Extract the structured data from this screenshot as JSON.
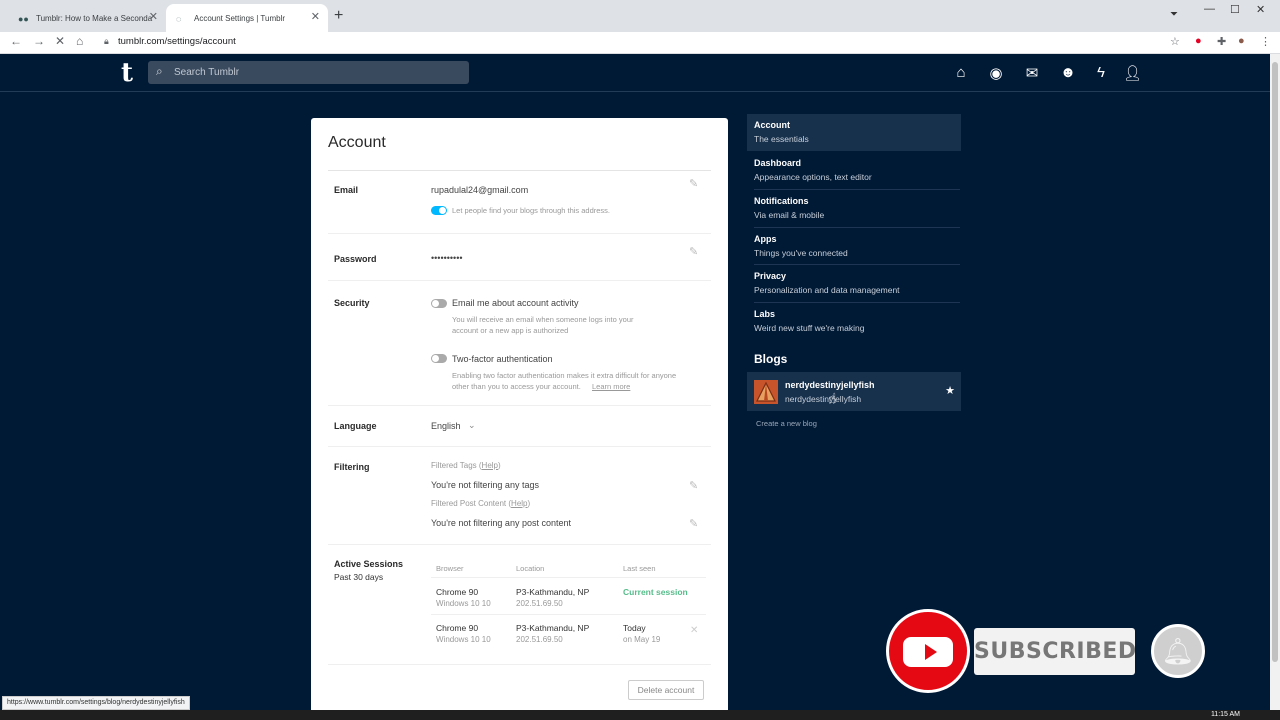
{
  "browser": {
    "tabs": [
      {
        "title": "Tumblr: How to Make a Seconda"
      },
      {
        "title": "Account Settings | Tumblr"
      }
    ],
    "url": "tumblr.com/settings/account",
    "status_url": "https://www.tumblr.com/settings/blog/nerdydestinyjellyfish"
  },
  "header": {
    "logo": "t",
    "search_placeholder": "Search Tumblr"
  },
  "account": {
    "title": "Account",
    "email_label": "Email",
    "email_value": "rupadulal24@gmail.com",
    "email_toggle_text": "Let people find your blogs through this address.",
    "password_label": "Password",
    "password_value": "••••••••••",
    "security_label": "Security",
    "security_opt1": "Email me about account activity",
    "security_opt1_desc1": "You will receive an email when someone logs into your",
    "security_opt1_desc2": "account or a new app is authorized",
    "security_opt2": "Two-factor authentication",
    "security_opt2_desc1": "Enabling two factor authentication makes it extra difficult for anyone",
    "security_opt2_desc2": "other than you to access your account.",
    "learn_more": "Learn more",
    "language_label": "Language",
    "language_value": "English",
    "filtering_label": "Filtering",
    "filtered_tags": "Filtered Tags",
    "filtered_tags_help": "Help",
    "filtered_tags_value": "You're not filtering any tags",
    "filtered_content": "Filtered Post Content",
    "filtered_content_help": "Help",
    "filtered_content_value": "You're not filtering any post content",
    "sessions_label": "Active Sessions",
    "sessions_sub": "Past 30 days",
    "sessions_headers": [
      "Browser",
      "Location",
      "Last seen"
    ],
    "sessions": [
      {
        "browser": "Chrome 90",
        "os": "Windows 10 10",
        "location": "P3-Kathmandu, NP",
        "ip": "202.51.69.50",
        "seen": "Current session",
        "seen_sub": ""
      },
      {
        "browser": "Chrome 90",
        "os": "Windows 10 10",
        "location": "P3-Kathmandu, NP",
        "ip": "202.51.69.50",
        "seen": "Today",
        "seen_sub": "on May 19"
      }
    ],
    "delete_account": "Delete account"
  },
  "sidebar": {
    "items": [
      {
        "title": "Account",
        "sub": "The essentials"
      },
      {
        "title": "Dashboard",
        "sub": "Appearance options, text editor"
      },
      {
        "title": "Notifications",
        "sub": "Via email & mobile"
      },
      {
        "title": "Apps",
        "sub": "Things you've connected"
      },
      {
        "title": "Privacy",
        "sub": "Personalization and data management"
      },
      {
        "title": "Labs",
        "sub": "Weird new stuff we're making"
      }
    ],
    "blogs_title": "Blogs",
    "blog_name": "nerdydestinyjellyfish",
    "blog_sub": "nerdydestinyjellyfish",
    "create_blog": "Create a new blog"
  },
  "overlay": {
    "subscribed": "SUBSCRIBED"
  },
  "taskbar": {
    "clock": "11:15 AM"
  }
}
